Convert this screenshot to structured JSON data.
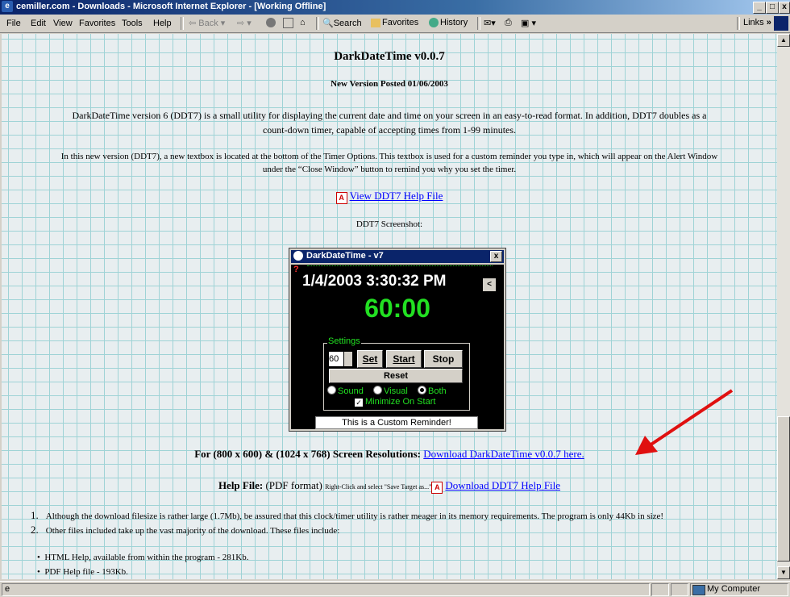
{
  "window": {
    "title": "cemiller.com - Downloads - Microsoft Internet Explorer - [Working Offline]",
    "min_label": "_",
    "max_label": "□",
    "close_label": "x"
  },
  "menu": {
    "items": [
      "File",
      "Edit",
      "View",
      "Favorites",
      "Tools",
      "Help"
    ]
  },
  "toolbar": {
    "back": "Back",
    "search": "Search",
    "favorites": "Favorites",
    "history": "History",
    "links": "Links",
    "links_chevron": "»"
  },
  "page": {
    "heading": "DarkDateTime v0.0.7",
    "subheading": "New Version Posted 01/06/2003",
    "para1_line1": "DarkDateTime version 6 (DDT7) is a small utility for displaying the current date and time on your screen in an easy-to-read format. In addition, DDT7 doubles as a",
    "para1_line2": "count-down timer, capable of accepting times from 1-99 minutes.",
    "para2_line1": "In this new version (DDT7), a new textbox is located at the bottom of the Timer Options. This textbox is used for a custom reminder you type in, which will appear on the Alert Window",
    "para2_line2": "under the “Close Window” button to remind you why you set the timer.",
    "help_link": "View DDT7 Help File",
    "screenshot_label": "DDT7 Screenshot:",
    "resolutions_label": "For (800 x 600) & (1024 x 768) Screen Resolutions:",
    "download_link": "Download DarkDateTime v0.0.7 here.",
    "helpfile_label": "Help File:",
    "pdf_format": "(PDF format)",
    "rightclick_note": "Right-Click and select \"Save Target as...\"",
    "download_help_link": "Download DDT7 Help File",
    "ordered": [
      {
        "num": "1.",
        "text": "Although the download filesize is rather large (1.7Mb), be assured that this clock/timer utility is rather meager in its memory requirements. The program is only 44Kb in size!"
      },
      {
        "num": "2.",
        "text": "Other files included take up the vast majority of the download. These files include:"
      }
    ],
    "bullets": [
      "HTML Help, available from within the program - 281Kb.",
      "PDF Help file - 193Kb."
    ]
  },
  "ddt": {
    "title": "DarkDateTime - v7",
    "close": "x",
    "datetime": "1/4/2003 3:30:32 PM",
    "timer": "60:00",
    "settings_label": "Settings",
    "minutes_value": "60",
    "set_label": "Set",
    "start_label": "Start",
    "stop_label": "Stop",
    "reset_label": "Reset",
    "opt_sound": "Sound",
    "opt_visual": "Visual",
    "opt_both": "Both",
    "minimize_label": "Minimize On Start",
    "reminder": "This is a Custom Reminder!",
    "help_mark": "?",
    "side_btn": "<",
    "colors": {
      "timer": "#22e022",
      "settings_text": "#22e022"
    }
  },
  "status": {
    "zone": "My Computer"
  },
  "colors": {
    "link": "#0000ff",
    "grid": "#9fd3d6",
    "titlebar": "#0a246a",
    "arrow": "#e01010"
  }
}
